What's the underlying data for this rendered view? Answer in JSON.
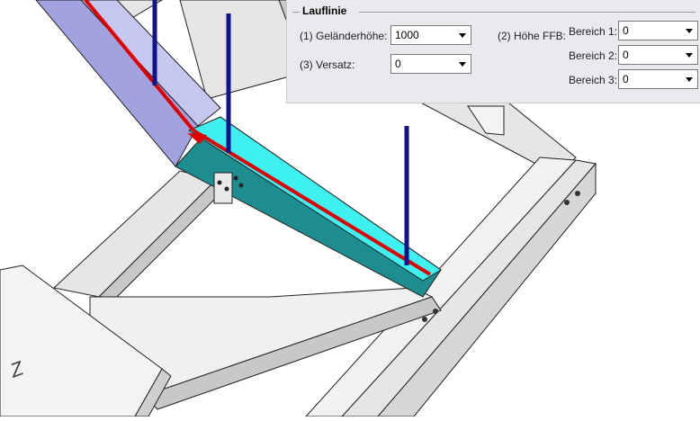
{
  "panel": {
    "group_title": "Lauflinie",
    "railing_height": {
      "label": "(1) Geländerhöhe:",
      "value": "1000"
    },
    "offset": {
      "label": "(3) Versatz:",
      "value": "0"
    },
    "ffb_height": {
      "label": "(2) Höhe FFB:"
    },
    "zones": [
      {
        "label": "Bereich 1:",
        "value": "0"
      },
      {
        "label": "Bereich 2:",
        "value": "0"
      },
      {
        "label": "Bereich 3:",
        "value": "0"
      }
    ]
  },
  "viewport": {
    "axis_label": "Z",
    "colors": {
      "steel_face": "#e6e6e6",
      "steel_shade": "#c8c8c8",
      "stringer_blue": "#a0a3e0",
      "beam_cyan": "#3ff0f0",
      "beam_cyan_dark": "#1e8d90",
      "walking_line": "#e00000",
      "posts": "#10138a"
    }
  }
}
